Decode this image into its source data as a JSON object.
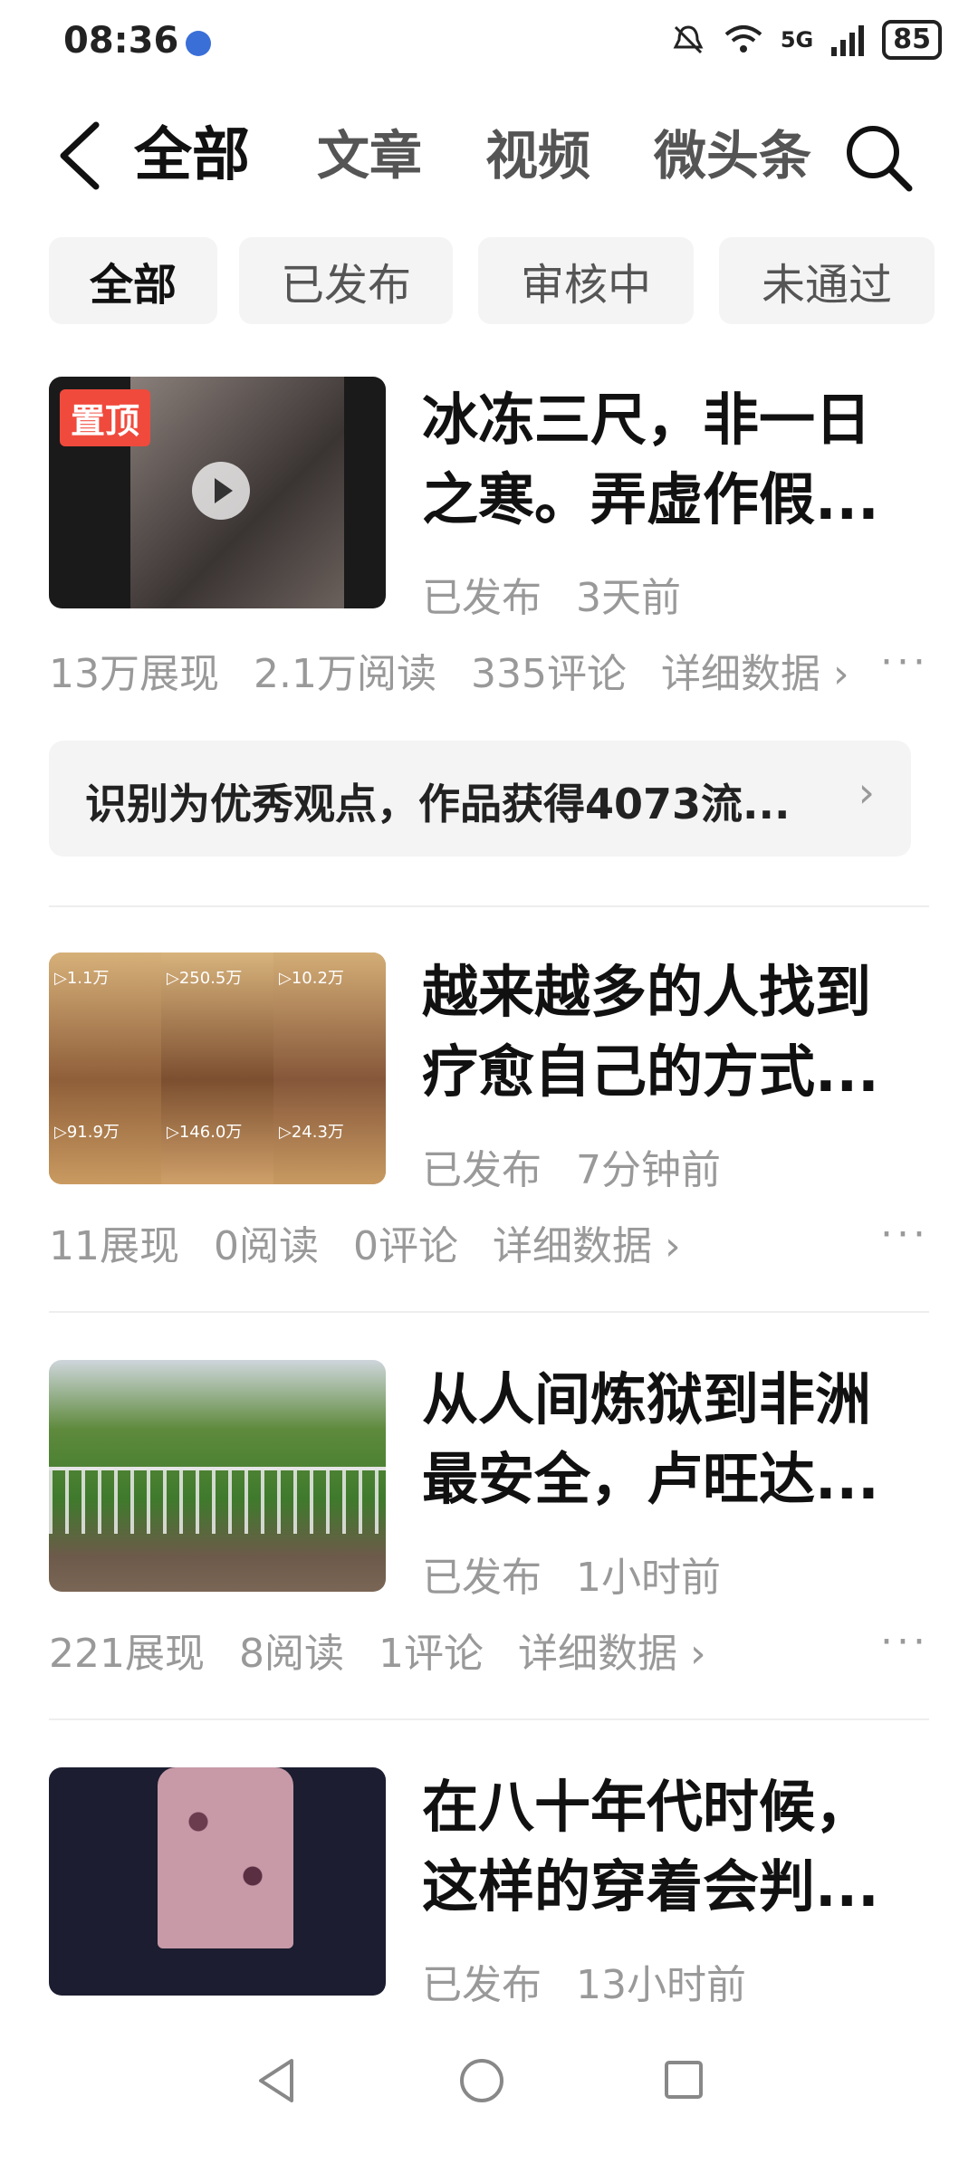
{
  "status_bar": {
    "time": "08:36",
    "signal": "5G",
    "battery": "85"
  },
  "nav": {
    "tabs": [
      "全部",
      "文章",
      "视频",
      "微头条"
    ]
  },
  "filters": [
    "全部",
    "已发布",
    "审核中",
    "未通过"
  ],
  "items": [
    {
      "badge": "置顶",
      "title_line1": "冰冻三尺，非一日",
      "title_line2": "之寒。弄虚作假...",
      "status": "已发布",
      "time": "3天前",
      "stats": [
        "13万展现",
        "2.1万阅读",
        "335评论",
        "详细数据 ›"
      ],
      "more": "···"
    },
    {
      "title_line1": "越来越多的人找到",
      "title_line2": "疗愈自己的方式...",
      "status": "已发布",
      "time": "7分钟前",
      "stats": [
        "11展现",
        "0阅读",
        "0评论",
        "详细数据 ›"
      ],
      "more": "···",
      "thumb_labels": [
        "▷1.1万",
        "▷250.5万",
        "▷10.2万",
        "▷91.9万",
        "▷146.0万",
        "▷24.3万"
      ]
    },
    {
      "title_line1": "从人间炼狱到非洲",
      "title_line2": "最安全，卢旺达...",
      "status": "已发布",
      "time": "1小时前",
      "stats": [
        "221展现",
        "8阅读",
        "1评论",
        "详细数据 ›"
      ],
      "more": "···"
    },
    {
      "title_line1": "在八十年代时候，",
      "title_line2": "这样的穿着会判...",
      "status": "已发布",
      "time": "13小时前"
    }
  ],
  "notice": {
    "text": "识别为优秀观点，作品获得4073流...",
    "arrow": "›"
  },
  "colors": {
    "badge": "#f04a3d",
    "chip_bg": "#f4f4f4",
    "muted_text": "#999999"
  }
}
